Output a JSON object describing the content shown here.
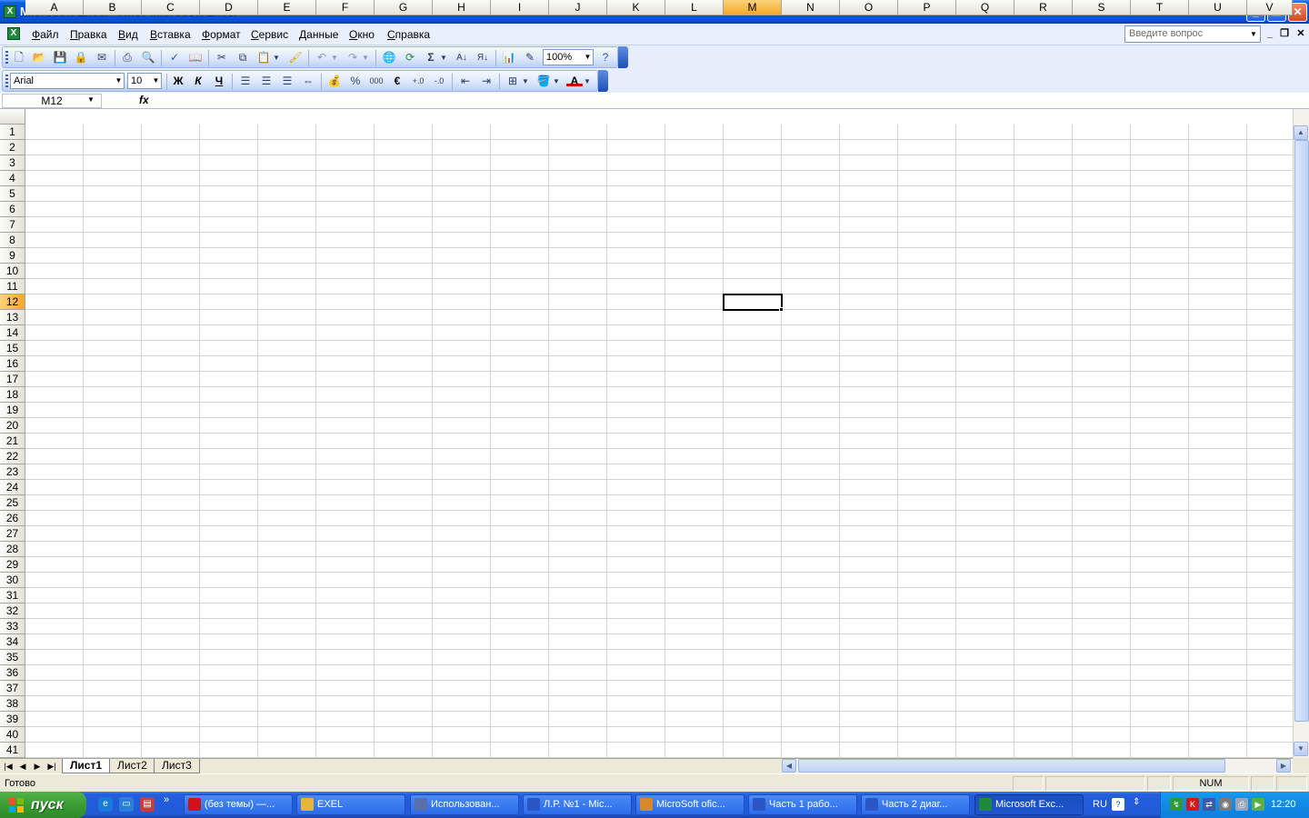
{
  "window": {
    "title": "Microsoft Excel - Лист Microsoft Excel",
    "minimize": "_",
    "restore": "❐",
    "close": "✕"
  },
  "menu": {
    "items": [
      "Файл",
      "Правка",
      "Вид",
      "Вставка",
      "Формат",
      "Сервис",
      "Данные",
      "Окно",
      "Справка"
    ],
    "help_placeholder": "Введите вопрос"
  },
  "toolbar": {
    "zoom": "100%",
    "font": "Arial",
    "font_size": "10",
    "bold_label": "Ж",
    "italic_label": "К",
    "underline_label": "Ч",
    "percent_label": "%",
    "thousands_label": "000",
    "euro_label": "€",
    "sum_label": "Σ"
  },
  "formula_bar": {
    "name_box": "M12",
    "fx_label": "fx",
    "formula": ""
  },
  "grid": {
    "columns": [
      "A",
      "B",
      "C",
      "D",
      "E",
      "F",
      "G",
      "H",
      "I",
      "J",
      "K",
      "L",
      "M",
      "N",
      "O",
      "P",
      "Q",
      "R",
      "S",
      "T",
      "U",
      "V"
    ],
    "row_count": 41,
    "active_column": "M",
    "active_row": 12
  },
  "sheets": {
    "tabs": [
      "Лист1",
      "Лист2",
      "Лист3"
    ],
    "active": "Лист1"
  },
  "status": {
    "ready": "Готово",
    "num": "NUM"
  },
  "taskbar": {
    "start_label": "пуск",
    "tasks": [
      {
        "label": "(без темы) —...",
        "icon": "opera-icon",
        "color": "#d0121a",
        "active": false
      },
      {
        "label": "EXEL",
        "icon": "folder-icon",
        "color": "#e8b53a",
        "active": false
      },
      {
        "label": "Использован...",
        "icon": "app-icon",
        "color": "#5a6fa8",
        "active": false
      },
      {
        "label": "Л.Р. №1 - Mic...",
        "icon": "word-icon",
        "color": "#2a56c6",
        "active": false
      },
      {
        "label": "MicroSoft ofic...",
        "icon": "paint-icon",
        "color": "#d88a2a",
        "active": false
      },
      {
        "label": "Часть 1 рабо...",
        "icon": "word-icon",
        "color": "#2a56c6",
        "active": false
      },
      {
        "label": "Часть 2 диаг...",
        "icon": "word-icon",
        "color": "#2a56c6",
        "active": false
      },
      {
        "label": "Microsoft Exc...",
        "icon": "excel-icon",
        "color": "#1f8a3c",
        "active": true
      }
    ],
    "language": "RU",
    "clock": "12:20"
  }
}
